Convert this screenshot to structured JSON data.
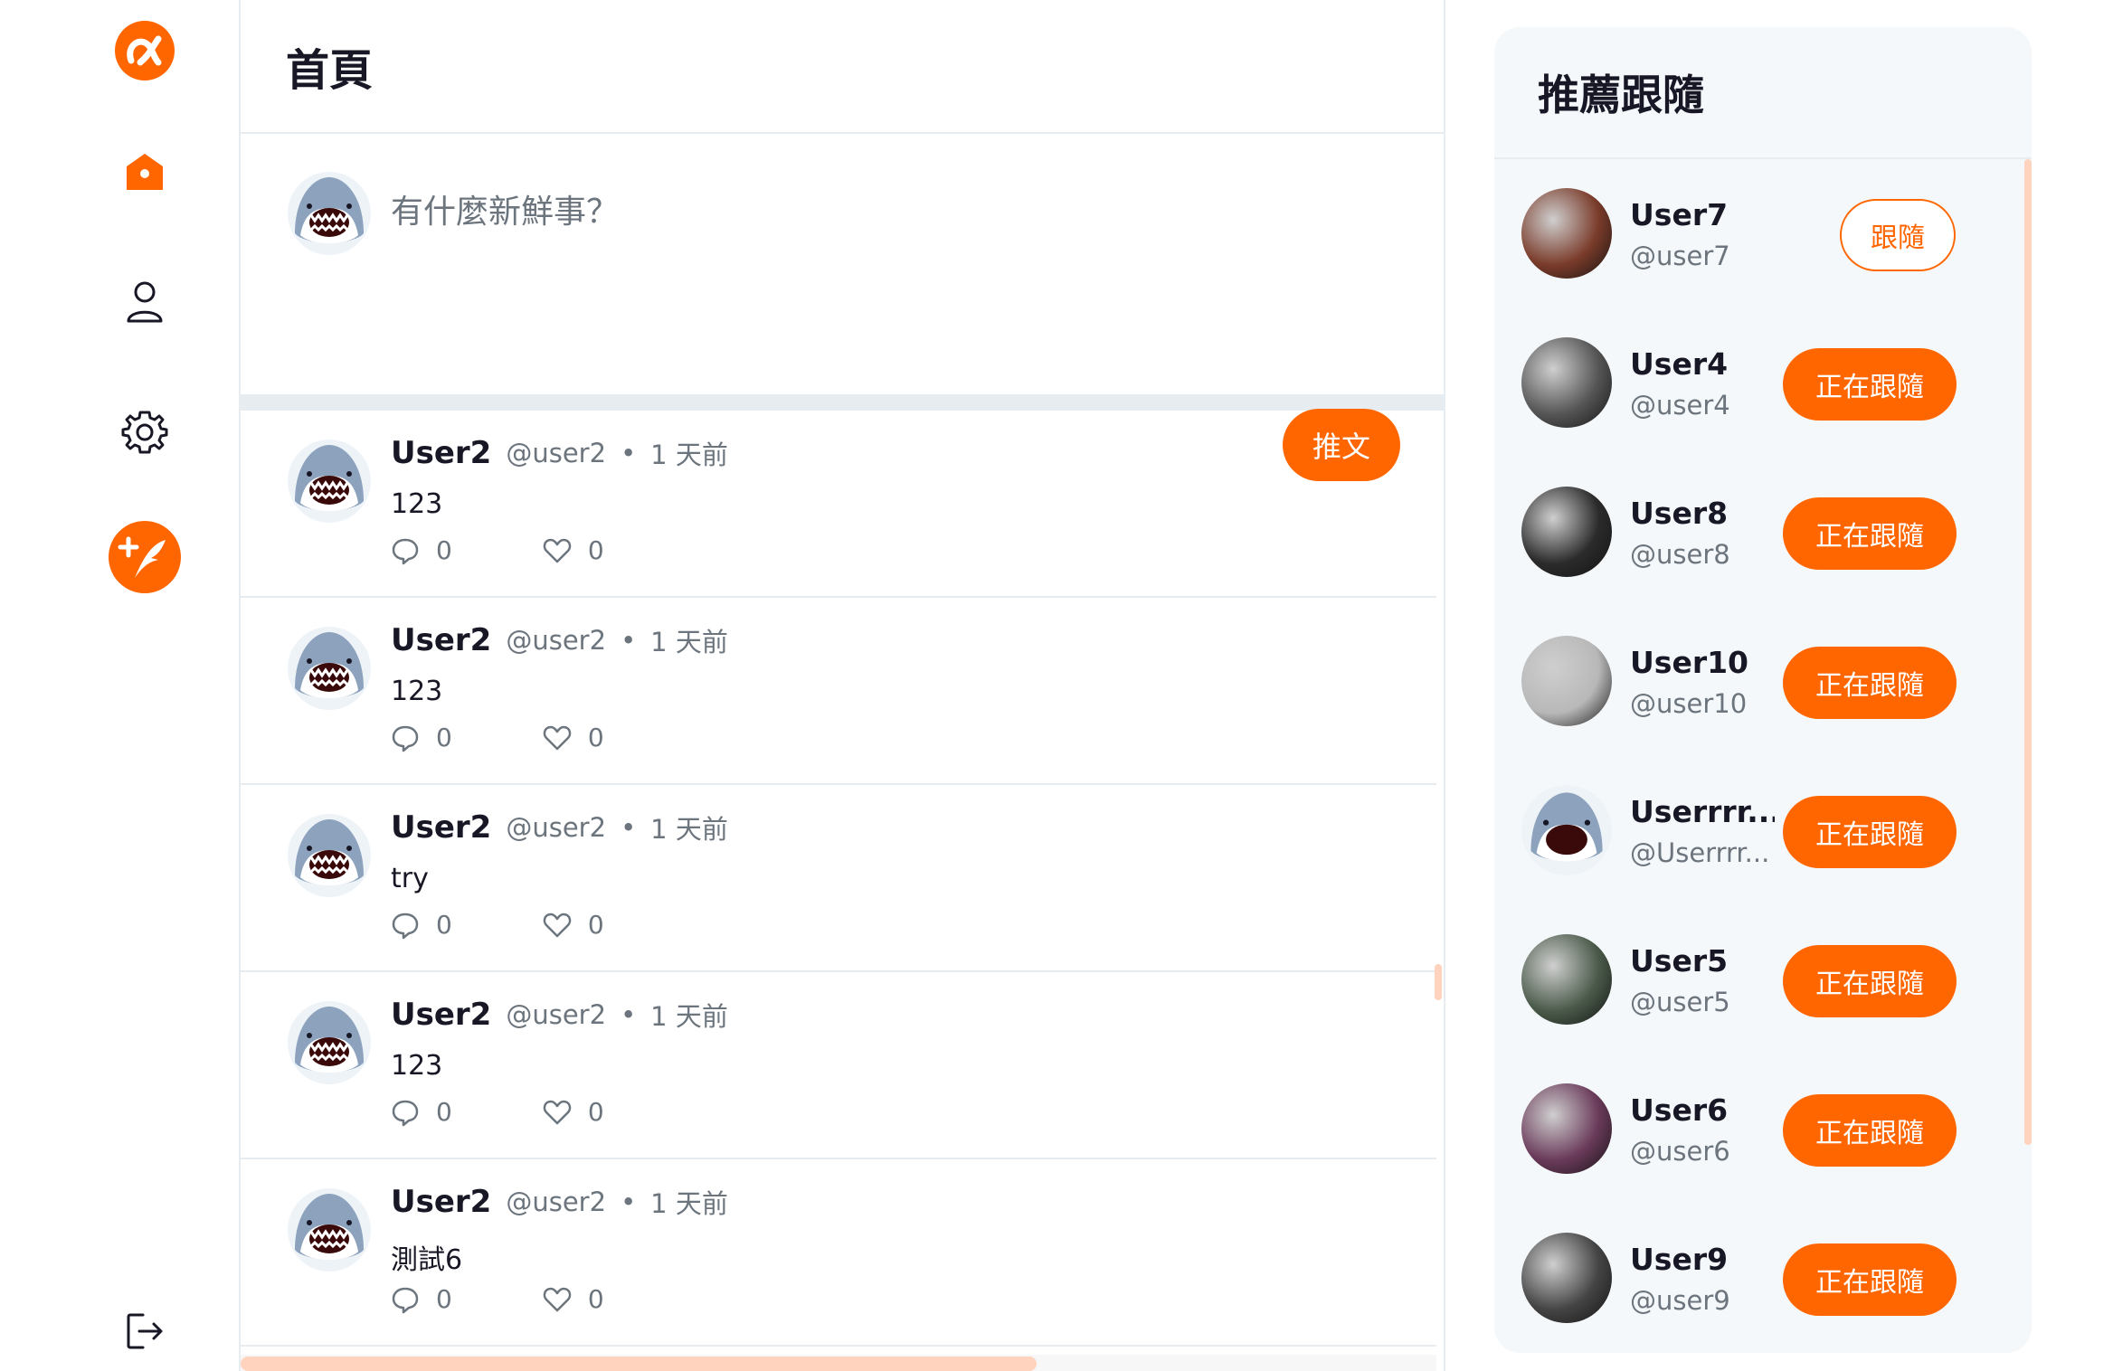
{
  "colors": {
    "accent": "#ff6600",
    "border": "#e6ecf0",
    "muted": "#6c757d",
    "panel": "#f5f8fa"
  },
  "nav": {
    "icons": [
      "logo-icon",
      "home-icon",
      "user-icon",
      "gear-icon",
      "add-tweet-icon",
      "logout-icon"
    ]
  },
  "main": {
    "title": "首頁",
    "composer": {
      "placeholder": "有什麼新鮮事？",
      "submit_label": "推文"
    },
    "posts": [
      {
        "name": "User2",
        "handle": "@user2",
        "dot": "•",
        "time": "1 天前",
        "body": "123",
        "replies": "0",
        "likes": "0"
      },
      {
        "name": "User2",
        "handle": "@user2",
        "dot": "•",
        "time": "1 天前",
        "body": "123",
        "replies": "0",
        "likes": "0"
      },
      {
        "name": "User2",
        "handle": "@user2",
        "dot": "•",
        "time": "1 天前",
        "body": "try",
        "replies": "0",
        "likes": "0"
      },
      {
        "name": "User2",
        "handle": "@user2",
        "dot": "•",
        "time": "1 天前",
        "body": "123",
        "replies": "0",
        "likes": "0"
      },
      {
        "name": "User2",
        "handle": "@user2",
        "dot": "•",
        "time": "1 天前",
        "body": "測試6",
        "replies": "0",
        "likes": "0"
      }
    ]
  },
  "recommend": {
    "title": "推薦跟隨",
    "users": [
      {
        "name": "User7",
        "handle": "@user7",
        "button": "跟隨",
        "following": false,
        "photo_color": "#7a3b2a"
      },
      {
        "name": "User4",
        "handle": "@user4",
        "button": "正在跟隨",
        "following": true,
        "photo_color": "#555555"
      },
      {
        "name": "User8",
        "handle": "@user8",
        "button": "正在跟隨",
        "following": true,
        "photo_color": "#2b2b2b"
      },
      {
        "name": "User10",
        "handle": "@user10",
        "button": "正在跟隨",
        "following": true,
        "photo_color": "#b8b8b8"
      },
      {
        "name": "Userrrr...",
        "handle": "@Userrrr...",
        "button": "正在跟隨",
        "following": true,
        "photo_color": "shark"
      },
      {
        "name": "User5",
        "handle": "@user5",
        "button": "正在跟隨",
        "following": true,
        "photo_color": "#4a5a4a"
      },
      {
        "name": "User6",
        "handle": "@user6",
        "button": "正在跟隨",
        "following": true,
        "photo_color": "#6a3a5a"
      },
      {
        "name": "User9",
        "handle": "@user9",
        "button": "正在跟隨",
        "following": true,
        "photo_color": "#444444"
      }
    ]
  }
}
